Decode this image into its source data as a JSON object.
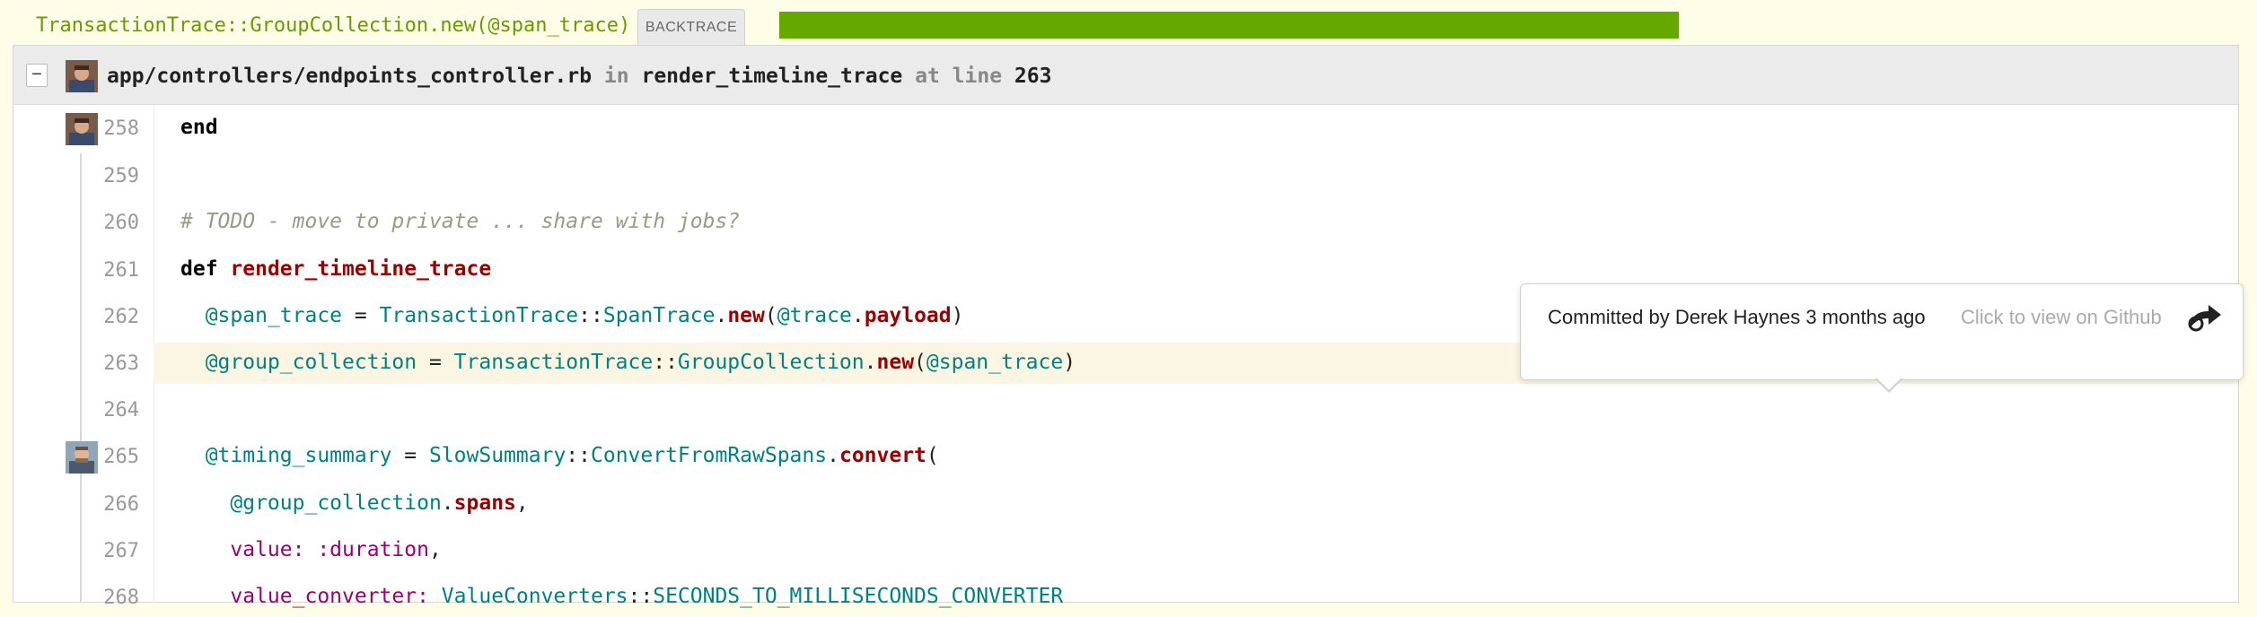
{
  "topbar": {
    "title": "TransactionTrace::GroupCollection.new(@span_trace)",
    "tab_label": "BACKTRACE",
    "progress": 1.0,
    "progress_color": "#65a800"
  },
  "panel": {
    "collapse_label": "−",
    "file": "app/controllers/endpoints_controller.rb",
    "in_word": "in",
    "method": "render_timeline_trace",
    "at_line_word": "at line",
    "line": "263"
  },
  "code": {
    "line_numbers": [
      "258",
      "259",
      "260",
      "261",
      "262",
      "263",
      "264",
      "265",
      "266",
      "267",
      "268"
    ],
    "l258": {
      "kw": "end"
    },
    "l260": {
      "comment": "# TODO - move to private ... share with jobs?"
    },
    "l261": {
      "kw": "def",
      "fn": "render_timeline_trace"
    },
    "l262": {
      "ivar": "@span_trace",
      "eq": " = ",
      "const1": "TransactionTrace",
      "sep": "::",
      "const2": "SpanTrace",
      "dot": ".",
      "fn": "new",
      "open": "(",
      "ivar2": "@trace",
      "dot2": ".",
      "fn2": "payload",
      "close": ")"
    },
    "l263": {
      "ivar": "@group_collection",
      "eq": " = ",
      "const1": "TransactionTrace",
      "sep": "::",
      "const2": "GroupCollection",
      "dot": ".",
      "fn": "new",
      "open": "(",
      "ivar2": "@span_trace",
      "close": ")"
    },
    "l265": {
      "ivar": "@timing_summary",
      "eq": " = ",
      "const1": "SlowSummary",
      "sep": "::",
      "const2": "ConvertFromRawSpans",
      "dot": ".",
      "fn": "convert",
      "open": "("
    },
    "l266": {
      "ivar": "@group_collection",
      "dot": ".",
      "fn": "spans",
      "comma": ","
    },
    "l267": {
      "key": "value:",
      "sym": " :duration",
      "comma": ","
    },
    "l268": {
      "key": "value_converter:",
      "const1": " ValueConverters",
      "sep": "::",
      "const2": "SECONDS_TO_MILLISECONDS_CONVERTER"
    }
  },
  "tooltip": {
    "text": "Committed by Derek Haynes 3 months ago",
    "link": "Click to view on Github",
    "icon": "share-arrow-icon"
  }
}
